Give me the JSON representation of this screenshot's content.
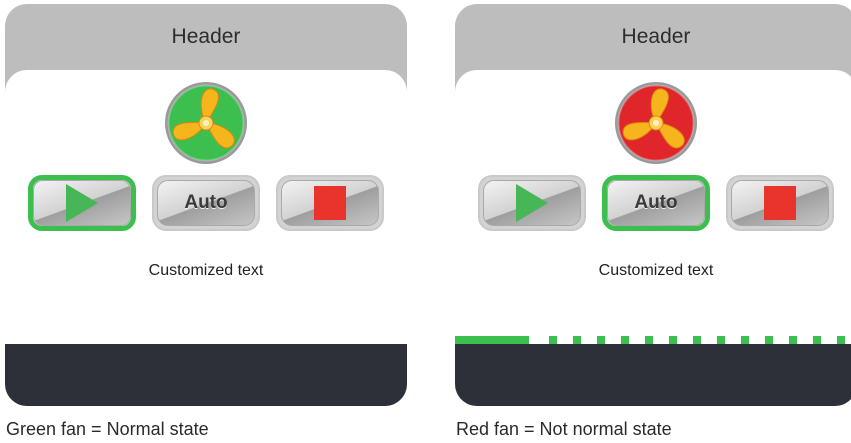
{
  "panels": [
    {
      "header": "Header",
      "fan": {
        "state": "normal",
        "color": "#3dbf4f",
        "icon": "fan-icon"
      },
      "buttons": [
        {
          "id": "play",
          "label": "",
          "icon": "play-icon",
          "active": true
        },
        {
          "id": "auto",
          "label": "Auto",
          "active": false
        },
        {
          "id": "stop",
          "label": "",
          "icon": "stop-icon",
          "active": false
        }
      ],
      "text": "Customized text",
      "progress_strip": false
    },
    {
      "header": "Header",
      "fan": {
        "state": "not normal",
        "color": "#e0262a",
        "icon": "fan-icon"
      },
      "buttons": [
        {
          "id": "play",
          "label": "",
          "icon": "play-icon",
          "active": false
        },
        {
          "id": "auto",
          "label": "Auto",
          "active": true
        },
        {
          "id": "stop",
          "label": "",
          "icon": "stop-icon",
          "active": false
        }
      ],
      "text": "Customized text",
      "progress_strip": true
    }
  ],
  "captions": {
    "normal": "Green fan = Normal state",
    "alert": "Red fan = Not normal state"
  },
  "colors": {
    "active_border": "#3dbf4f",
    "fan_normal": "#3dbf4f",
    "fan_alert": "#e0262a",
    "play": "#46b657",
    "stop": "#e8342c",
    "footer": "#2e3039",
    "header_bg": "#bdbdbd"
  }
}
